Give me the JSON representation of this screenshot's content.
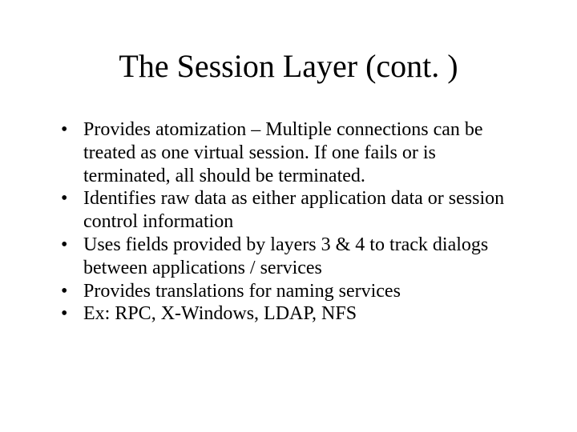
{
  "slide": {
    "title": "The Session Layer (cont. )",
    "bullets": [
      "Provides atomization – Multiple connections can be treated as one virtual session.  If one fails or is terminated, all should be terminated.",
      "Identifies raw data as either application data or session control information",
      "Uses fields provided by layers 3 & 4 to track dialogs between applications / services",
      "Provides translations for naming services",
      "Ex: RPC, X-Windows, LDAP, NFS"
    ]
  }
}
